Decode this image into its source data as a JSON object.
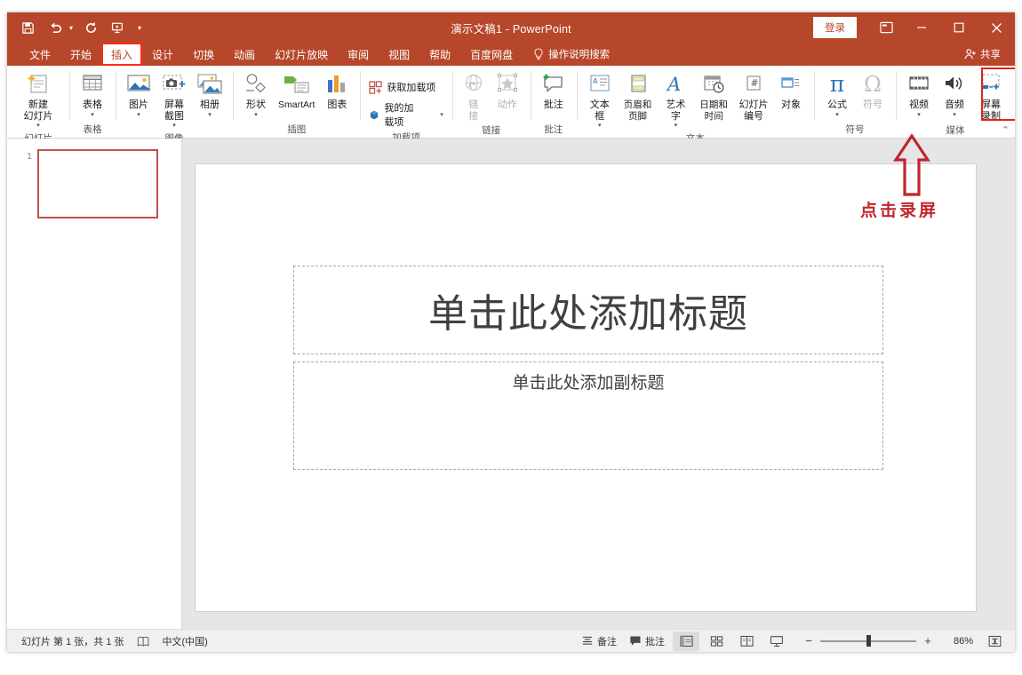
{
  "window": {
    "title": "演示文稿1  -  PowerPoint",
    "signin_label": "登录",
    "ribbon_display_icon": "ribbon-display-options-icon",
    "minimize_icon": "minimize-icon",
    "maximize_icon": "maximize-icon",
    "close_icon": "close-icon"
  },
  "quick_access": [
    {
      "name": "save",
      "icon": "save-icon"
    },
    {
      "name": "undo",
      "icon": "undo-icon"
    },
    {
      "name": "redo",
      "icon": "redo-icon"
    },
    {
      "name": "start-from-beginning",
      "icon": "slideshow-icon"
    },
    {
      "name": "customize-quick-access-toolbar",
      "icon": "chevron-down-icon"
    }
  ],
  "tabs": [
    {
      "label": "文件",
      "active": false
    },
    {
      "label": "开始",
      "active": false
    },
    {
      "label": "插入",
      "active": true
    },
    {
      "label": "设计",
      "active": false
    },
    {
      "label": "切换",
      "active": false
    },
    {
      "label": "动画",
      "active": false
    },
    {
      "label": "幻灯片放映",
      "active": false
    },
    {
      "label": "审阅",
      "active": false
    },
    {
      "label": "视图",
      "active": false
    },
    {
      "label": "帮助",
      "active": false
    },
    {
      "label": "百度网盘",
      "active": false
    }
  ],
  "tell_me": "操作说明搜索",
  "share_label": "共享",
  "collapse_ribbon": "⌃",
  "ribbon": {
    "groups": [
      {
        "label": "幻灯片",
        "items": [
          {
            "label": "新建\n幻灯片",
            "icon": "new-slide-icon",
            "dropdown": true,
            "disabled": false
          }
        ]
      },
      {
        "label": "表格",
        "items": [
          {
            "label": "表格",
            "icon": "table-icon",
            "dropdown": true,
            "disabled": false
          }
        ]
      },
      {
        "label": "图像",
        "items": [
          {
            "label": "图片",
            "icon": "picture-icon",
            "dropdown": true,
            "disabled": false
          },
          {
            "label": "屏幕截图",
            "icon": "screenshot-icon",
            "dropdown": true,
            "disabled": false
          },
          {
            "label": "相册",
            "icon": "photo-album-icon",
            "dropdown": true,
            "disabled": false
          }
        ]
      },
      {
        "label": "插图",
        "items": [
          {
            "label": "形状",
            "icon": "shapes-icon",
            "dropdown": true,
            "disabled": false
          },
          {
            "label": "SmartArt",
            "icon": "smartart-icon",
            "dropdown": false,
            "disabled": false
          },
          {
            "label": "图表",
            "icon": "chart-icon",
            "dropdown": false,
            "disabled": false
          }
        ]
      },
      {
        "label": "加载项",
        "small_items": [
          {
            "label": "获取加载项",
            "icon": "get-addins-icon",
            "dropdown": false
          },
          {
            "label": "我的加载项",
            "icon": "my-addins-icon",
            "dropdown": true
          }
        ]
      },
      {
        "label": "链接",
        "items": [
          {
            "label": "链\n接",
            "icon": "link-icon",
            "dropdown": false,
            "disabled": true
          },
          {
            "label": "动作",
            "icon": "action-icon",
            "dropdown": false,
            "disabled": true
          }
        ]
      },
      {
        "label": "批注",
        "items": [
          {
            "label": "批注",
            "icon": "comment-icon",
            "dropdown": false,
            "disabled": false
          }
        ]
      },
      {
        "label": "文本",
        "items": [
          {
            "label": "文本框",
            "icon": "textbox-icon",
            "dropdown": true,
            "disabled": false
          },
          {
            "label": "页眉和页脚",
            "icon": "header-footer-icon",
            "dropdown": false,
            "disabled": false
          },
          {
            "label": "艺术字",
            "icon": "wordart-icon",
            "dropdown": true,
            "disabled": false
          },
          {
            "label": "日期和时间",
            "icon": "date-time-icon",
            "dropdown": false,
            "disabled": false
          },
          {
            "label": "幻灯片\n编号",
            "icon": "slide-number-icon",
            "dropdown": false,
            "disabled": false
          },
          {
            "label": "对象",
            "icon": "object-icon",
            "dropdown": false,
            "disabled": false
          }
        ]
      },
      {
        "label": "符号",
        "items": [
          {
            "label": "公式",
            "icon": "equation-icon",
            "glyph": "π",
            "dropdown": true,
            "disabled": false
          },
          {
            "label": "符号",
            "icon": "symbol-icon",
            "glyph": "Ω",
            "dropdown": false,
            "disabled": true
          }
        ]
      },
      {
        "label": "媒体",
        "items": [
          {
            "label": "视频",
            "icon": "video-icon",
            "dropdown": true,
            "disabled": false
          },
          {
            "label": "音频",
            "icon": "audio-icon",
            "dropdown": true,
            "disabled": false
          },
          {
            "label": "屏幕\n录制",
            "icon": "screen-recording-icon",
            "dropdown": false,
            "disabled": false,
            "highlighted": true
          }
        ]
      }
    ]
  },
  "thumbnails": [
    {
      "number": "1",
      "selected": true
    }
  ],
  "slide": {
    "title_placeholder": "单击此处添加标题",
    "subtitle_placeholder": "单击此处添加副标题"
  },
  "annotation": {
    "text": "点击录屏",
    "arrow_icon": "up-arrow-annotation-icon",
    "color": "#c0262c"
  },
  "status_bar": {
    "slide_count": "幻灯片 第 1 张，共 1 张",
    "accessibility_icon": "accessibility-checker-icon",
    "language": "中文(中国)",
    "notes_label": "备注",
    "comments_label": "批注",
    "views": [
      {
        "name": "normal-view",
        "icon": "normal-view-icon",
        "active": true
      },
      {
        "name": "slide-sorter-view",
        "icon": "slide-sorter-icon",
        "active": false
      },
      {
        "name": "reading-view",
        "icon": "reading-view-icon",
        "active": false
      },
      {
        "name": "slide-show-view",
        "icon": "slide-show-icon",
        "active": false
      }
    ],
    "zoom_out": "−",
    "zoom_in": "+",
    "zoom_level": "86%",
    "fit_window_icon": "fit-to-window-icon"
  },
  "colors": {
    "accent": "#b7472a",
    "highlight": "#e2231a",
    "thumb_border": "#c0504d",
    "annotation": "#c0262c"
  }
}
